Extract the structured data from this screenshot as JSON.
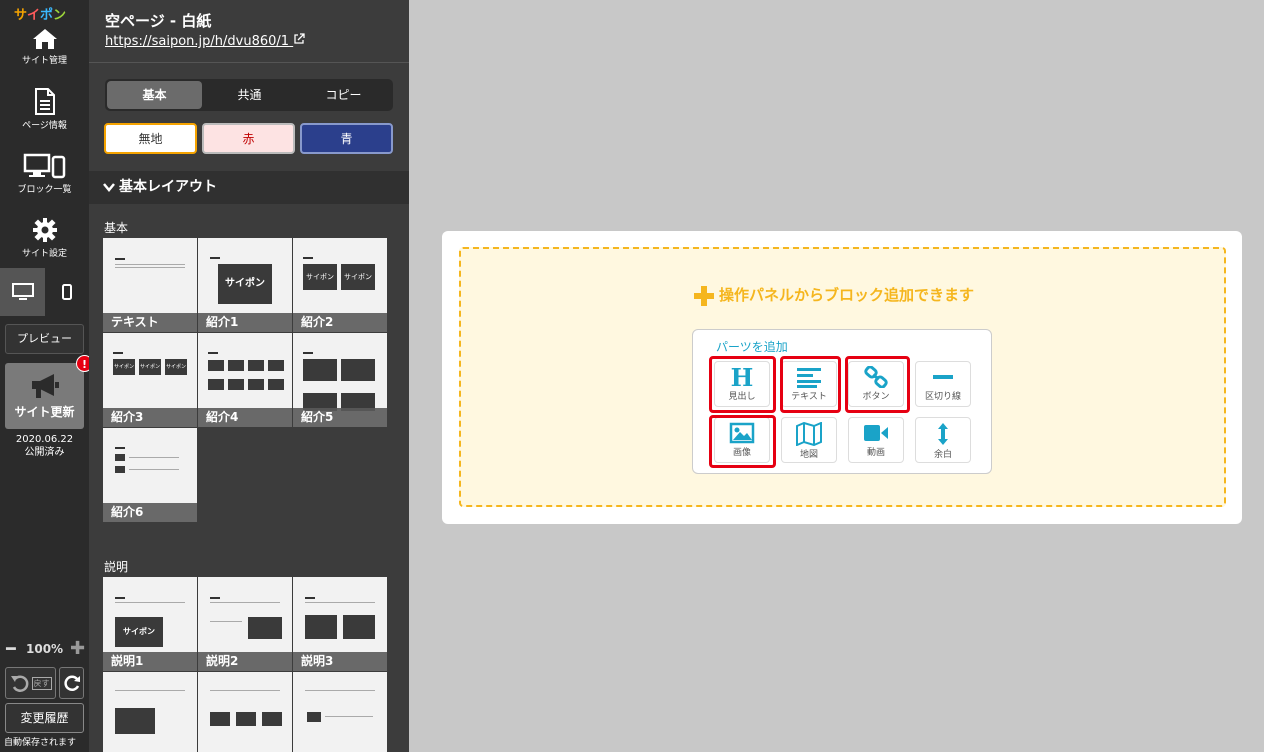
{
  "rail": {
    "logo": [
      "サ",
      "イ",
      "ポ",
      "ン"
    ],
    "site_manage": "サイト管理",
    "page_info": "ページ情報",
    "block_list": "ブロック一覧",
    "site_settings": "サイト設定",
    "preview": "プレビュー",
    "site_update": "サイト更新",
    "badge": "!",
    "publish_date": "2020.06.22",
    "publish_status": "公開済み",
    "zoom": "100%",
    "undo_label": "戻す",
    "history": "変更履歴",
    "autosave": "自動保存されます"
  },
  "panel": {
    "page_title": "空ページ - 白紙",
    "page_url": "https://saipon.jp/h/dvu860/1",
    "tabs": [
      "基本",
      "共通",
      "コピー"
    ],
    "color_options": [
      {
        "label": "無地",
        "bg": "#ffffff",
        "fg": "#333333",
        "border": "#f5a300"
      },
      {
        "label": "赤",
        "bg": "#fde3e3",
        "fg": "#c00000",
        "border": "#d99"
      },
      {
        "label": "青",
        "bg": "#2b3f8c",
        "fg": "#ffffff",
        "border": "#7788bb"
      }
    ],
    "section_title": "基本レイアウト",
    "group_basic": "基本",
    "group_desc": "説明",
    "basic_thumbs": [
      "テキスト",
      "紹介1",
      "紹介2",
      "紹介3",
      "紹介4",
      "紹介5",
      "紹介6"
    ],
    "desc_thumbs": [
      "説明1",
      "説明2",
      "説明3"
    ],
    "mock_text": "サイポン"
  },
  "canvas": {
    "hint": "操作パネルからブロック追加できます",
    "parts_title": "パーツを追加",
    "parts": [
      {
        "label": "見出し",
        "icon": "heading-icon",
        "highlighted": true
      },
      {
        "label": "テキスト",
        "icon": "text-icon",
        "highlighted": true
      },
      {
        "label": "ボタン",
        "icon": "link-icon",
        "highlighted": true
      },
      {
        "label": "区切り線",
        "icon": "divider-icon",
        "highlighted": false
      },
      {
        "label": "画像",
        "icon": "image-icon",
        "highlighted": true
      },
      {
        "label": "地図",
        "icon": "map-icon",
        "highlighted": false
      },
      {
        "label": "動画",
        "icon": "video-icon",
        "highlighted": false
      },
      {
        "label": "余白",
        "icon": "spacing-icon",
        "highlighted": false
      }
    ],
    "accent": "#f5b61e",
    "icon_color": "#1aa3c8",
    "highlight_color": "#e60012"
  }
}
